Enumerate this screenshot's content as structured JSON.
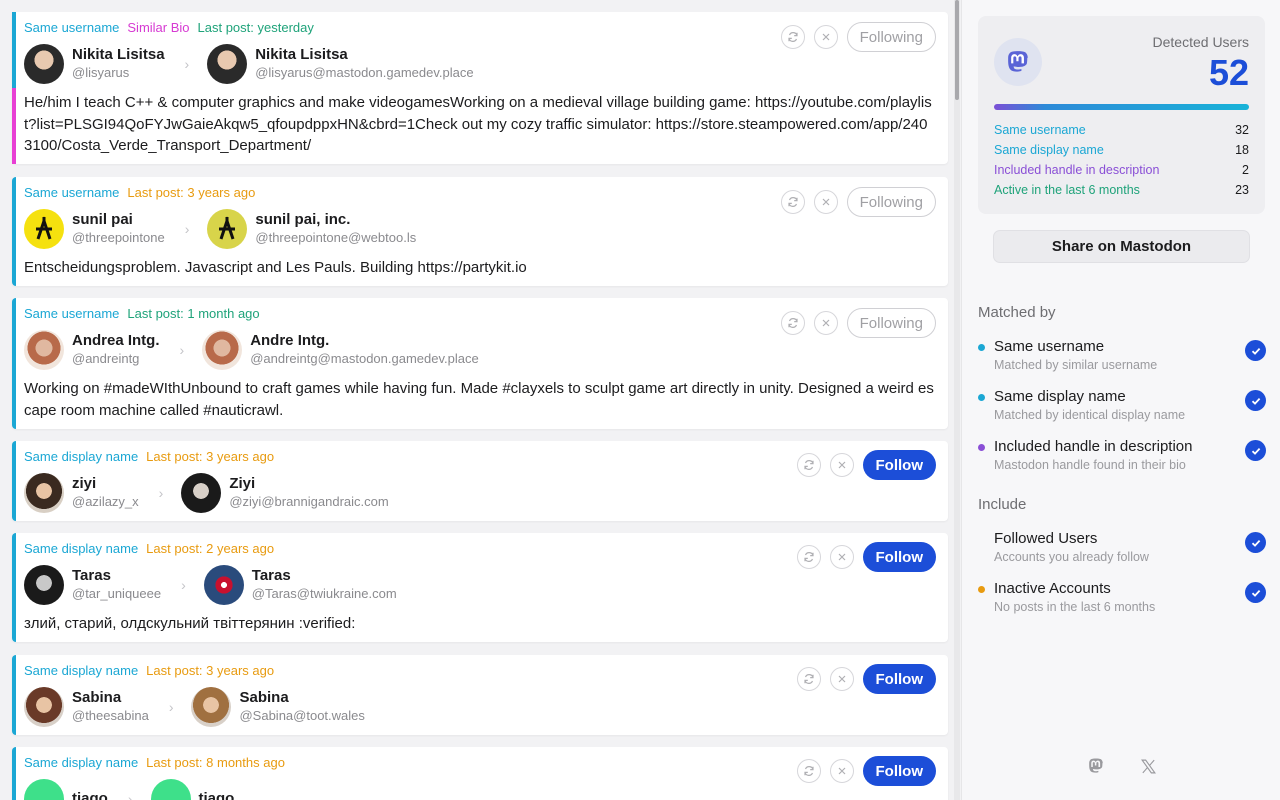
{
  "feed": {
    "cards": [
      {
        "tags": [
          {
            "text": "Same username",
            "kind": "username"
          },
          {
            "text": "Similar Bio",
            "kind": "bio"
          },
          {
            "text": "Last post: yesterday",
            "kind": "green"
          }
        ],
        "left": {
          "name": "Nikita Lisitsa",
          "handle": "@lisyarus"
        },
        "right": {
          "name": "Nikita Lisitsa",
          "handle": "@lisyarus@mastodon.gamedev.place"
        },
        "description": "He/him I teach C++ & computer graphics and make videogamesWorking on a medieval village building game: https://youtube.com/playlist?list=PLSGI94QoFYJwGaieAkqw5_qfoupdppxHN&cbrd=1Check out my cozy traffic simulator: https://store.steampowered.com/app/2403100/Costa_Verde_Transport_Department/",
        "action": "Following"
      },
      {
        "tags": [
          {
            "text": "Same username",
            "kind": "username"
          },
          {
            "text": "Last post: 3 years ago",
            "kind": "orange"
          }
        ],
        "left": {
          "name": "sunil pai",
          "handle": "@threepointone"
        },
        "right": {
          "name": "sunil pai, inc.",
          "handle": "@threepointone@webtoo.ls"
        },
        "description": "Entscheidungsproblem.  Javascript and Les Pauls. Building https://partykit.io",
        "action": "Following"
      },
      {
        "tags": [
          {
            "text": "Same username",
            "kind": "username"
          },
          {
            "text": "Last post: 1 month ago",
            "kind": "green"
          }
        ],
        "left": {
          "name": "Andrea Intg.",
          "handle": "@andreintg"
        },
        "right": {
          "name": "Andre Intg.",
          "handle": "@andreintg@mastodon.gamedev.place"
        },
        "description": "Working on #madeWIthUnbound to craft games while having fun. Made #clayxels to sculpt game art directly in unity. Designed a weird escape room machine called #nauticrawl.",
        "action": "Following"
      },
      {
        "tags": [
          {
            "text": "Same display name",
            "kind": "display"
          },
          {
            "text": "Last post: 3 years ago",
            "kind": "orange"
          }
        ],
        "left": {
          "name": "ziyi",
          "handle": "@azilazy_x"
        },
        "right": {
          "name": "Ziyi",
          "handle": "@ziyi@brannigandraic.com"
        },
        "description": "",
        "action": "Follow"
      },
      {
        "tags": [
          {
            "text": "Same display name",
            "kind": "display"
          },
          {
            "text": "Last post: 2 years ago",
            "kind": "orange"
          }
        ],
        "left": {
          "name": "Taras",
          "handle": "@tar_uniqueee"
        },
        "right": {
          "name": "Taras",
          "handle": "@Taras@twiukraine.com"
        },
        "description": "злий, старий, олдскульний твіттерянин :verified:",
        "action": "Follow"
      },
      {
        "tags": [
          {
            "text": "Same display name",
            "kind": "display"
          },
          {
            "text": "Last post: 3 years ago",
            "kind": "orange"
          }
        ],
        "left": {
          "name": "Sabina",
          "handle": "@theesabina"
        },
        "right": {
          "name": "Sabina",
          "handle": "@Sabina@toot.wales"
        },
        "description": "",
        "action": "Follow"
      },
      {
        "tags": [
          {
            "text": "Same display name",
            "kind": "display"
          },
          {
            "text": "Last post: 8 months ago",
            "kind": "orange"
          }
        ],
        "left": {
          "name": "tiago",
          "handle": ""
        },
        "right": {
          "name": "tiago",
          "handle": ""
        },
        "description": "",
        "action": "Follow"
      }
    ]
  },
  "sidebar": {
    "detected_label": "Detected Users",
    "detected_count": "52",
    "stats": [
      {
        "label": "Same username",
        "value": "32",
        "color": "blue"
      },
      {
        "label": "Same display name",
        "value": "18",
        "color": "blue"
      },
      {
        "label": "Included handle in description",
        "value": "2",
        "color": "purple"
      },
      {
        "label": "Active in the last 6 months",
        "value": "23",
        "color": "green"
      }
    ],
    "share_label": "Share on Mastodon",
    "matched_by_title": "Matched by",
    "matched_by": [
      {
        "title": "Same username",
        "subtitle": "Matched by similar username",
        "dot": "#1ba7d4"
      },
      {
        "title": "Same display name",
        "subtitle": "Matched by identical display name",
        "dot": "#1ba7d4"
      },
      {
        "title": "Included handle in description",
        "subtitle": "Mastodon handle found in their bio",
        "dot": "#8a4fd6"
      }
    ],
    "include_title": "Include",
    "include": [
      {
        "title": "Followed Users",
        "subtitle": "Accounts you already follow",
        "dot": ""
      },
      {
        "title": "Inactive Accounts",
        "subtitle": "No posts in the last 6 months",
        "dot": "#e89b10"
      }
    ],
    "footer_icons": [
      "mastodon-icon",
      "x-icon"
    ]
  },
  "colors": {
    "accent": "#1c4ed8",
    "username": "#1ba7d4",
    "bio": "#d63ad2",
    "green": "#1fa37a",
    "orange": "#e89b10"
  }
}
